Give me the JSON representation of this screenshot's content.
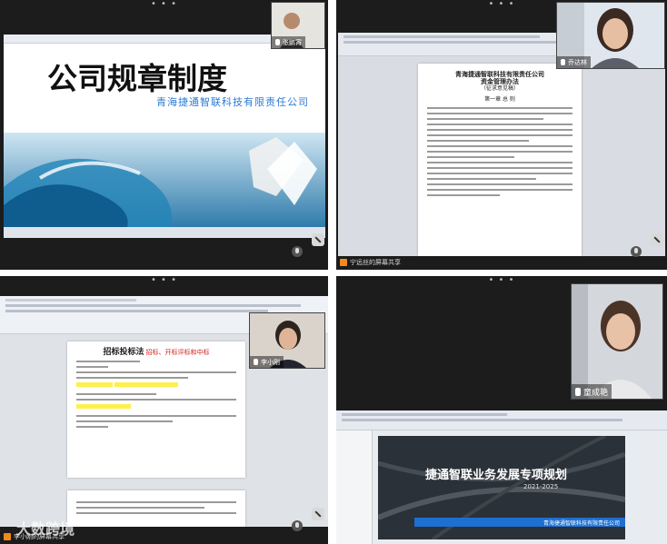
{
  "tiles": {
    "top_left": {
      "title": "公司规章制度",
      "subtitle": "青海捷通智联科技有限责任公司",
      "participant": "张鹏宵"
    },
    "top_right": {
      "doc_company": "青海捷通智联科技有限责任公司",
      "doc_title": "资金管理办法",
      "doc_status": "（征求意见稿）",
      "doc_chapter": "第一章 总 则",
      "participant": "乔达林",
      "share_label": "宁远丝的屏幕共享"
    },
    "bottom_left": {
      "doc_title": "招标投标法",
      "doc_title_suffix": "招标、开标评标和中标",
      "participant": "李小刚",
      "share_label": "李小刚的屏幕共享"
    },
    "bottom_right": {
      "participant": "童成艳",
      "slide_title": "捷通智联业务发展专项规划",
      "slide_years": "2021-2025",
      "slide_company": "青海捷通智联科技有限责任公司"
    }
  },
  "watermark": "大数跨境",
  "colors": {
    "title_black": "#111111",
    "title_blue": "#1f6fd0",
    "subtitle_blue": "#2a7bd8",
    "red_text": "#d42020",
    "slide_bg": "#2b3138"
  }
}
